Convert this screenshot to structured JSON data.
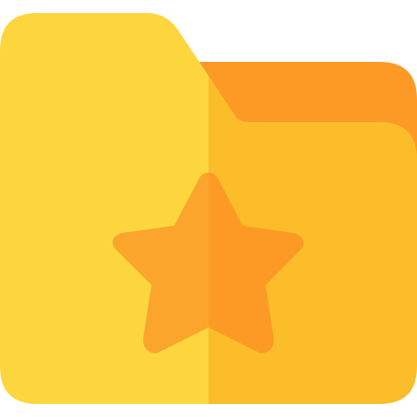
{
  "icon": {
    "name": "favorite-folder-icon",
    "colors": {
      "background": "#ffffff",
      "folder_left": "#fdd63e",
      "folder_right": "#fcbd2b",
      "folder_tab_back": "#fd9a26",
      "star_left": "#fba52c",
      "star_right": "#fd9a26"
    }
  }
}
